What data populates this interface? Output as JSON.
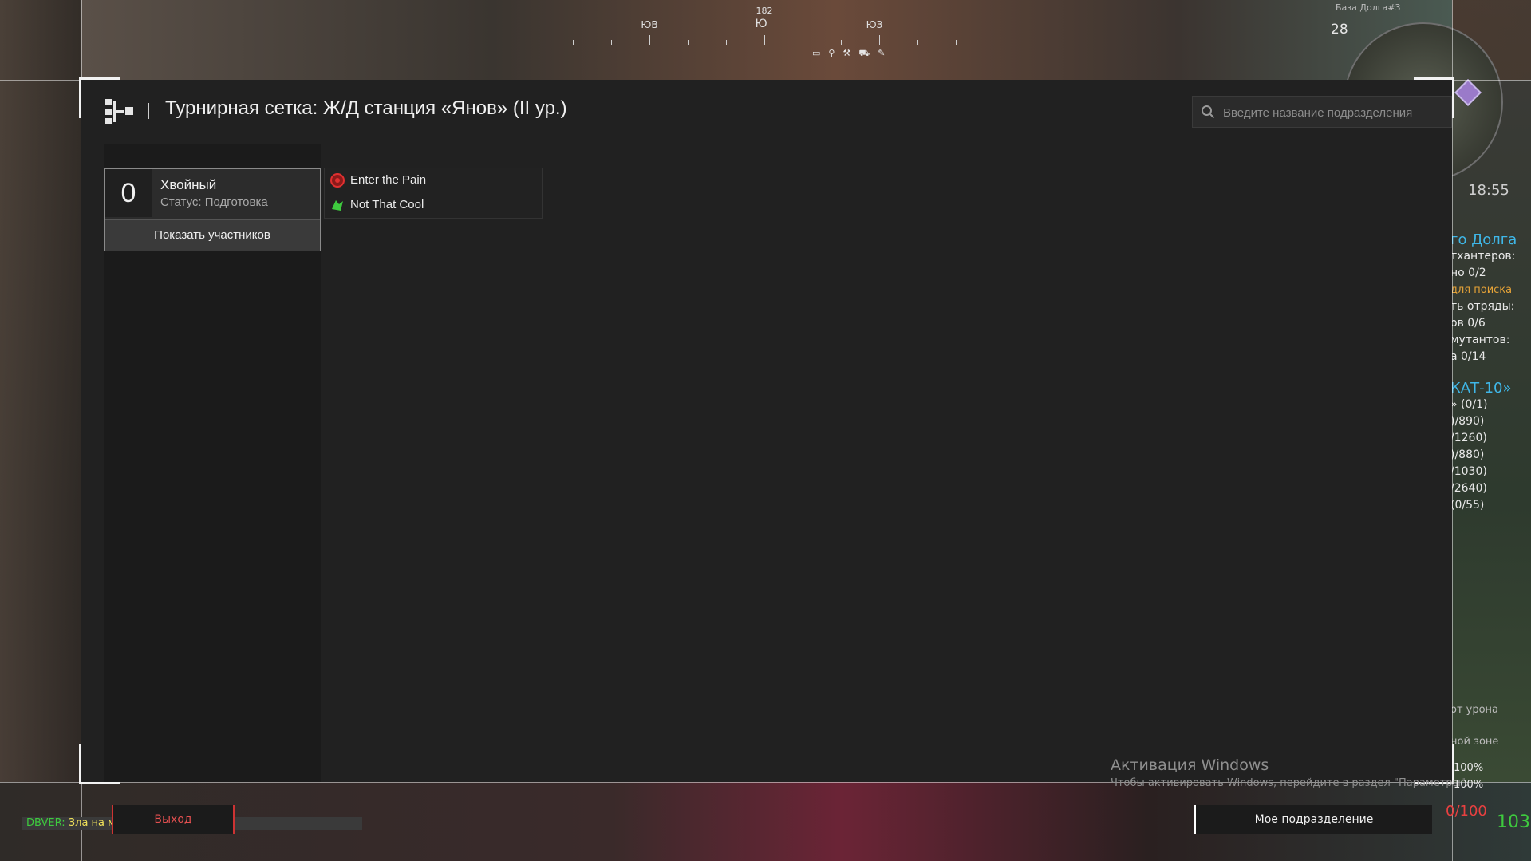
{
  "compass": {
    "left_label": "ЮВ",
    "center_label": "Ю",
    "bearing": "182",
    "right_label": "ЮЗ"
  },
  "minimap": {
    "title": "База Долга#3",
    "level": "28",
    "time": "18:55"
  },
  "dialog": {
    "title": "Турнирная сетка: Ж/Д станция «Янов» (II ур.)",
    "search_placeholder": "Введите название подразделения"
  },
  "team": {
    "number": "0",
    "name": "Хвойный",
    "status": "Статус: Подготовка",
    "show_members_label": "Показать участников"
  },
  "bracket": {
    "matches": [
      {
        "name": "Enter the Pain",
        "emblem": "red-emblem-icon",
        "color": "#d32f2f"
      },
      {
        "name": "Not That Cool",
        "emblem": "green-emblem-icon",
        "color": "#3ecb3e"
      }
    ]
  },
  "quests": {
    "head1": "го Долга",
    "l1": "тхантеров:",
    "l2": "но 0/2",
    "warn": "для поиска",
    "l3": "ть отряды:",
    "l4": "ов 0/6",
    "l5": "мутантов:",
    "l6": "а 0/14",
    "head2": "КАТ-10»",
    "l7": "» (0/1)",
    "l8": ")/890)",
    "l9": "/1260)",
    "l10": ")/880)",
    "l11": "/1030)",
    "l12": "/2640)",
    "l13": "(0/55)"
  },
  "hud": {
    "zone1": "от урона",
    "zone2": "ной зоне",
    "pct1": "100%",
    "pct2": "100%",
    "hp": "0/100",
    "ammo": "103",
    "chat_who": "DBVER:",
    "chat_text": "Зла на м",
    "exit_label": "Выход",
    "my_unit_label": "Мое подразделение"
  },
  "watermark": {
    "line1": "Активация Windows",
    "line2": "Чтобы активировать Windows, перейдите в раздел \"Параметры\"."
  }
}
